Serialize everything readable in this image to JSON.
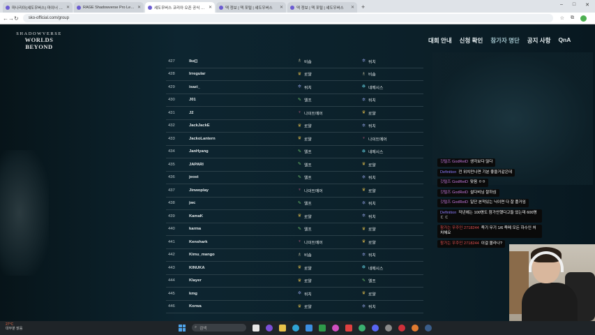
{
  "browser": {
    "tabs": [
      {
        "label": "마나리아(섀도우버스) 마이너 갤러리",
        "active": false
      },
      {
        "label": "RAGE Shadowverse Pro League",
        "active": false
      },
      {
        "label": "섀도우버스 코리아 오픈 공식 사이트",
        "active": true
      },
      {
        "label": "덱 정보 | 덱 포털 | 섀도우버스",
        "active": false
      },
      {
        "label": "덱 정보 | 덱 포털 | 섀도우버스",
        "active": false
      }
    ],
    "new_tab": "+",
    "url": "sko-official.com/group",
    "window_controls": [
      "–",
      "□",
      "✕"
    ]
  },
  "site": {
    "logo_line1": "SHADOWVERSE",
    "logo_line2": "WORLDS BEYOND",
    "nav": [
      {
        "label": "대회 안내",
        "active": false
      },
      {
        "label": "신청 확인",
        "active": false
      },
      {
        "label": "참가자 명단",
        "active": true
      },
      {
        "label": "공지 사항",
        "active": false
      },
      {
        "label": "QnA",
        "active": false
      }
    ]
  },
  "classes": {
    "royal": {
      "label": "로얄",
      "icon": "crown-icon",
      "color": "#d8b64a"
    },
    "elf": {
      "label": "엘프",
      "icon": "leaf-icon",
      "color": "#6fc36b"
    },
    "nightmare": {
      "label": "나이트메어",
      "icon": "nightmare-icon",
      "color": "#e0608c"
    },
    "witch": {
      "label": "위치",
      "icon": "witch-icon",
      "color": "#8f9fe0"
    },
    "bishop": {
      "label": "비숍",
      "icon": "bishop-icon",
      "color": "#d8cfa8"
    },
    "nemesis": {
      "label": "네메시스",
      "icon": "nemesis-icon",
      "color": "#5fc8d8"
    }
  },
  "participants": [
    {
      "num": "427",
      "name": "Ike[]",
      "a": "bishop",
      "b": "witch"
    },
    {
      "num": "428",
      "name": "Irregular",
      "a": "royal",
      "b": "bishop"
    },
    {
      "num": "429",
      "name": "isazi_",
      "a": "witch",
      "b": "nemesis"
    },
    {
      "num": "430",
      "name": "J01",
      "a": "elf",
      "b": "witch"
    },
    {
      "num": "431",
      "name": "J2",
      "a": "nightmare",
      "b": "royal"
    },
    {
      "num": "432",
      "name": "JackJackE",
      "a": "royal",
      "b": "witch"
    },
    {
      "num": "433",
      "name": "JackoLantern",
      "a": "royal",
      "b": "nightmare"
    },
    {
      "num": "434",
      "name": "JanHyang",
      "a": "elf",
      "b": "nemesis"
    },
    {
      "num": "435",
      "name": "JAPARI",
      "a": "elf",
      "b": "royal"
    },
    {
      "num": "436",
      "name": "jeost",
      "a": "elf",
      "b": "witch"
    },
    {
      "num": "437",
      "name": "Jinwoplay",
      "a": "nightmare",
      "b": "royal"
    },
    {
      "num": "438",
      "name": "jwc",
      "a": "elf",
      "b": "witch"
    },
    {
      "num": "439",
      "name": "KamaK",
      "a": "royal",
      "b": "witch"
    },
    {
      "num": "440",
      "name": "karma",
      "a": "elf",
      "b": "royal"
    },
    {
      "num": "441",
      "name": "Kenshark",
      "a": "nightmare",
      "b": "royal"
    },
    {
      "num": "442",
      "name": "Kimu_mango",
      "a": "bishop",
      "b": "witch"
    },
    {
      "num": "443",
      "name": "KINUKA",
      "a": "royal",
      "b": "nemesis"
    },
    {
      "num": "444",
      "name": "Klayer",
      "a": "royal",
      "b": "elf"
    },
    {
      "num": "445",
      "name": "kmg",
      "a": "witch",
      "b": "royal"
    },
    {
      "num": "446",
      "name": "Korwa",
      "a": "royal",
      "b": "witch"
    }
  ],
  "chat": [
    {
      "nick": "깃털즈 GodReiD",
      "text": "생각보다 많다",
      "color": "#c678dd"
    },
    {
      "nick": "Definition",
      "text": "전 위치만나면 기분 좋을거같은데",
      "color": "#8f7dff"
    },
    {
      "nick": "깃털즈 GodReiD",
      "text": "맞음 ㅇㅇ",
      "color": "#c678dd"
    },
    {
      "nick": "깃털즈 GodReiD",
      "text": "설다비님 잘하심",
      "color": "#c678dd"
    },
    {
      "nick": "깃털즈 GodReiD",
      "text": "일단 본적있는 닉이면 다 잘 플거임",
      "color": "#c678dd"
    },
    {
      "nick": "Definition",
      "text": "작년에는 100명도 참가안했다고들 었는데 600명 ㄷ ㄷ",
      "color": "#8f7dff"
    },
    {
      "nick": "참가는 우주인 2718244",
      "text": "죽기 무기 1/6 죽메 모든 하수인 처치해요",
      "color": "#e05050"
    },
    {
      "nick": "참가는 우주인 2718244",
      "text": "이걸 몰라나?",
      "color": "#e05050"
    }
  ],
  "taskbar": {
    "weather_temp": "27°C",
    "weather_text": "대부분 맑음",
    "search_placeholder": "검색"
  }
}
